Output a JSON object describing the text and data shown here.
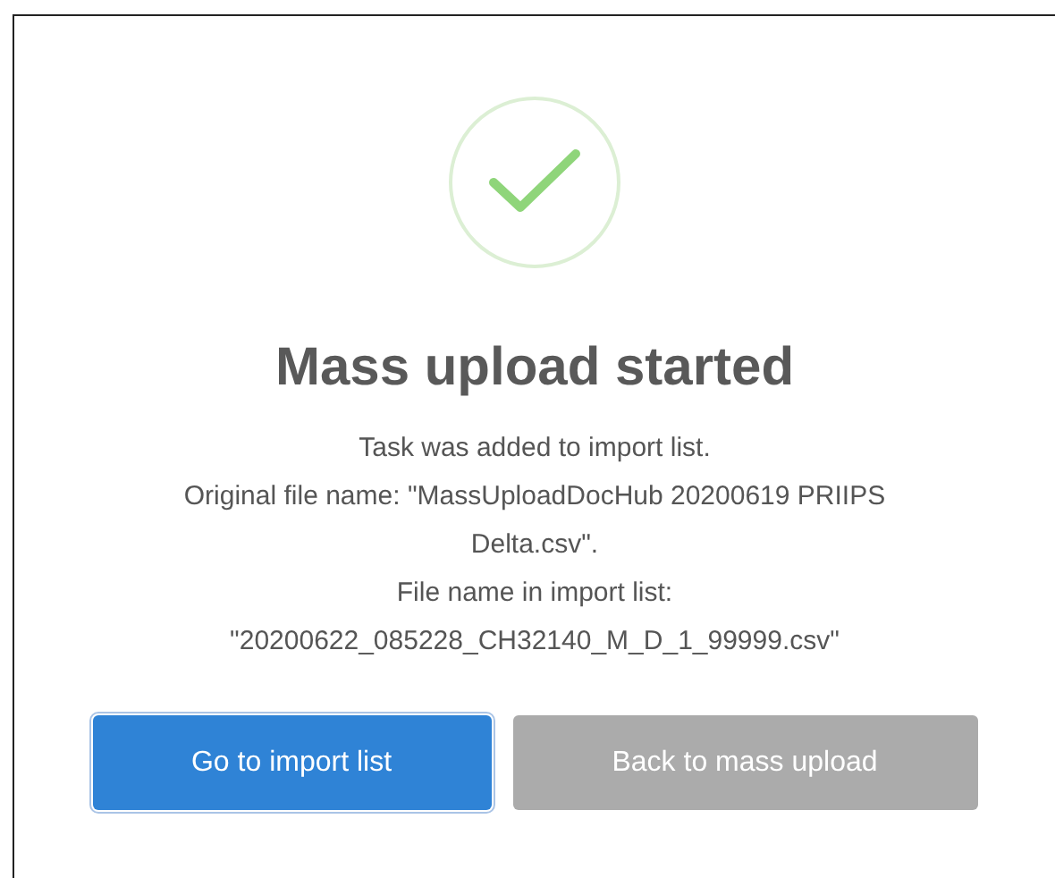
{
  "dialog": {
    "title": "Mass upload started",
    "message_lines": [
      "Task was added to import list.",
      "Original file name: \"MassUploadDocHub 20200619 PRIIPS",
      "Delta.csv\".",
      "File name in import list:",
      "\"20200622_085228_CH32140_M_D_1_99999.csv\""
    ],
    "buttons": [
      {
        "label": "Go to import list",
        "kind": "primary",
        "focused": true
      },
      {
        "label": "Back to mass upload",
        "kind": "secondary",
        "focused": false
      }
    ]
  }
}
